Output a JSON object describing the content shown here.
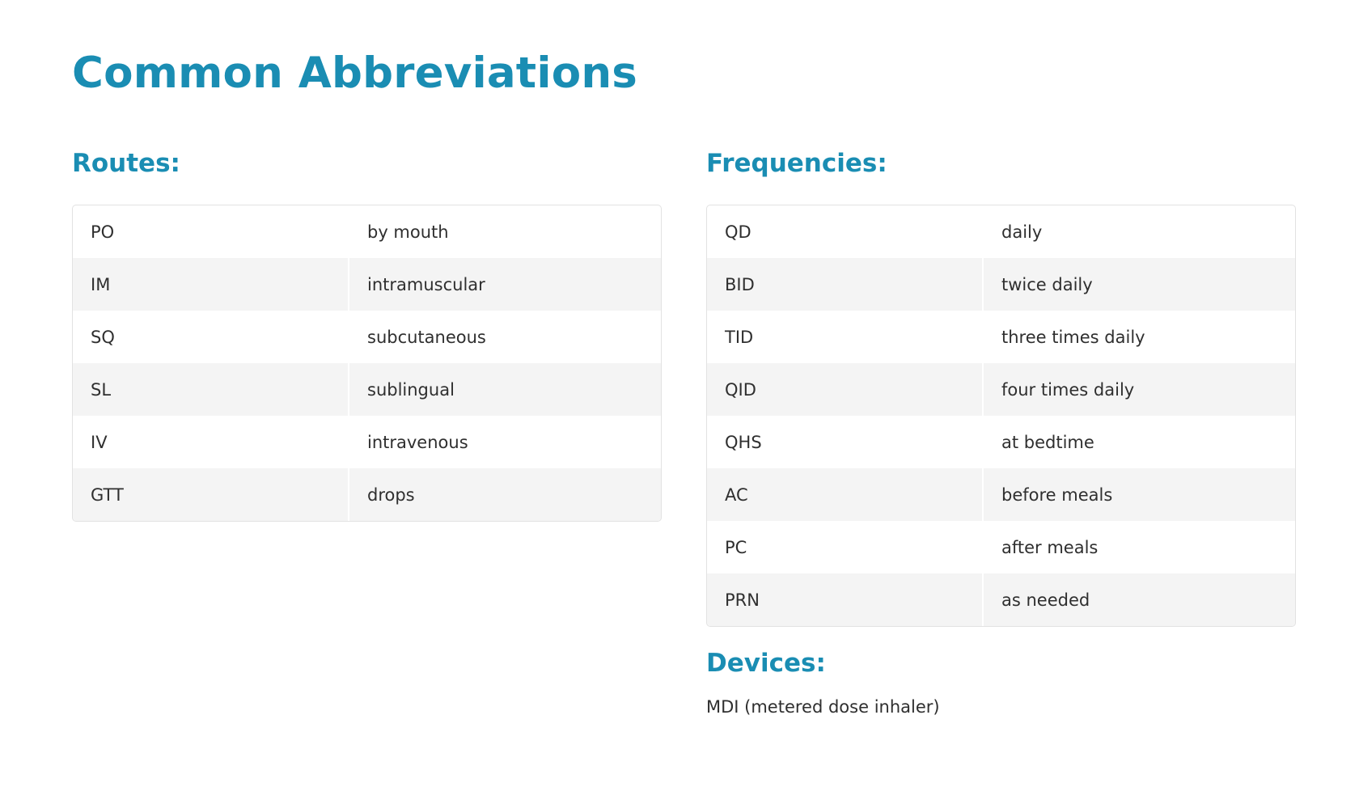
{
  "title": "Common Abbreviations",
  "routes": {
    "heading": "Routes:",
    "rows": [
      {
        "abbr": "PO",
        "meaning": "by mouth"
      },
      {
        "abbr": "IM",
        "meaning": "intramuscular"
      },
      {
        "abbr": "SQ",
        "meaning": "subcutaneous"
      },
      {
        "abbr": "SL",
        "meaning": "sublingual"
      },
      {
        "abbr": "IV",
        "meaning": "intravenous"
      },
      {
        "abbr": "GTT",
        "meaning": "drops"
      }
    ]
  },
  "frequencies": {
    "heading": "Frequencies:",
    "rows": [
      {
        "abbr": "QD",
        "meaning": "daily"
      },
      {
        "abbr": "BID",
        "meaning": "twice daily"
      },
      {
        "abbr": "TID",
        "meaning": "three times daily"
      },
      {
        "abbr": "QID",
        "meaning": "four times daily"
      },
      {
        "abbr": "QHS",
        "meaning": "at bedtime"
      },
      {
        "abbr": "AC",
        "meaning": "before meals"
      },
      {
        "abbr": "PC",
        "meaning": "after meals"
      },
      {
        "abbr": "PRN",
        "meaning": "as needed"
      }
    ]
  },
  "devices": {
    "heading": "Devices:",
    "text": "MDI (metered dose inhaler)"
  },
  "colors": {
    "accent": "#1a8db3",
    "row_alt": "#f4f4f4",
    "border": "#e2e2e2",
    "text": "#2f2f2f"
  }
}
